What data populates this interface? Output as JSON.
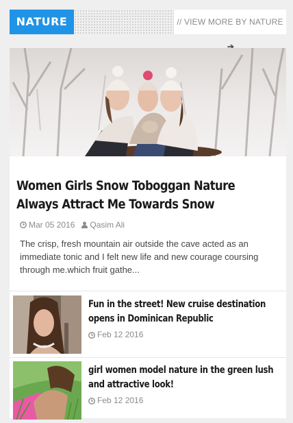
{
  "section": {
    "label": "NATURE",
    "view_more": "// VIEW MORE BY NATURE",
    "arrow_icon": "arrow-right-icon"
  },
  "featured": {
    "title": "Women Girls Snow Toboggan Nature Always Attract Me Towards Snow",
    "date": "Mar 05 2016",
    "author": "Qasim Ali",
    "excerpt": "The crisp, fresh mountain air outside the cave acted as an immediate tonic and I felt new life and new courage coursing through me.which fruit gathe..."
  },
  "list": [
    {
      "title": "Fun in the street! New cruise destination opens in Dominican Republic",
      "date": "Feb 12 2016"
    },
    {
      "title": "girl women model nature in the green lush and attractive look!",
      "date": "Feb 12 2016"
    }
  ],
  "colors": {
    "accent": "#1f93e6",
    "background": "#efefef",
    "meta": "#8a8a8a"
  }
}
